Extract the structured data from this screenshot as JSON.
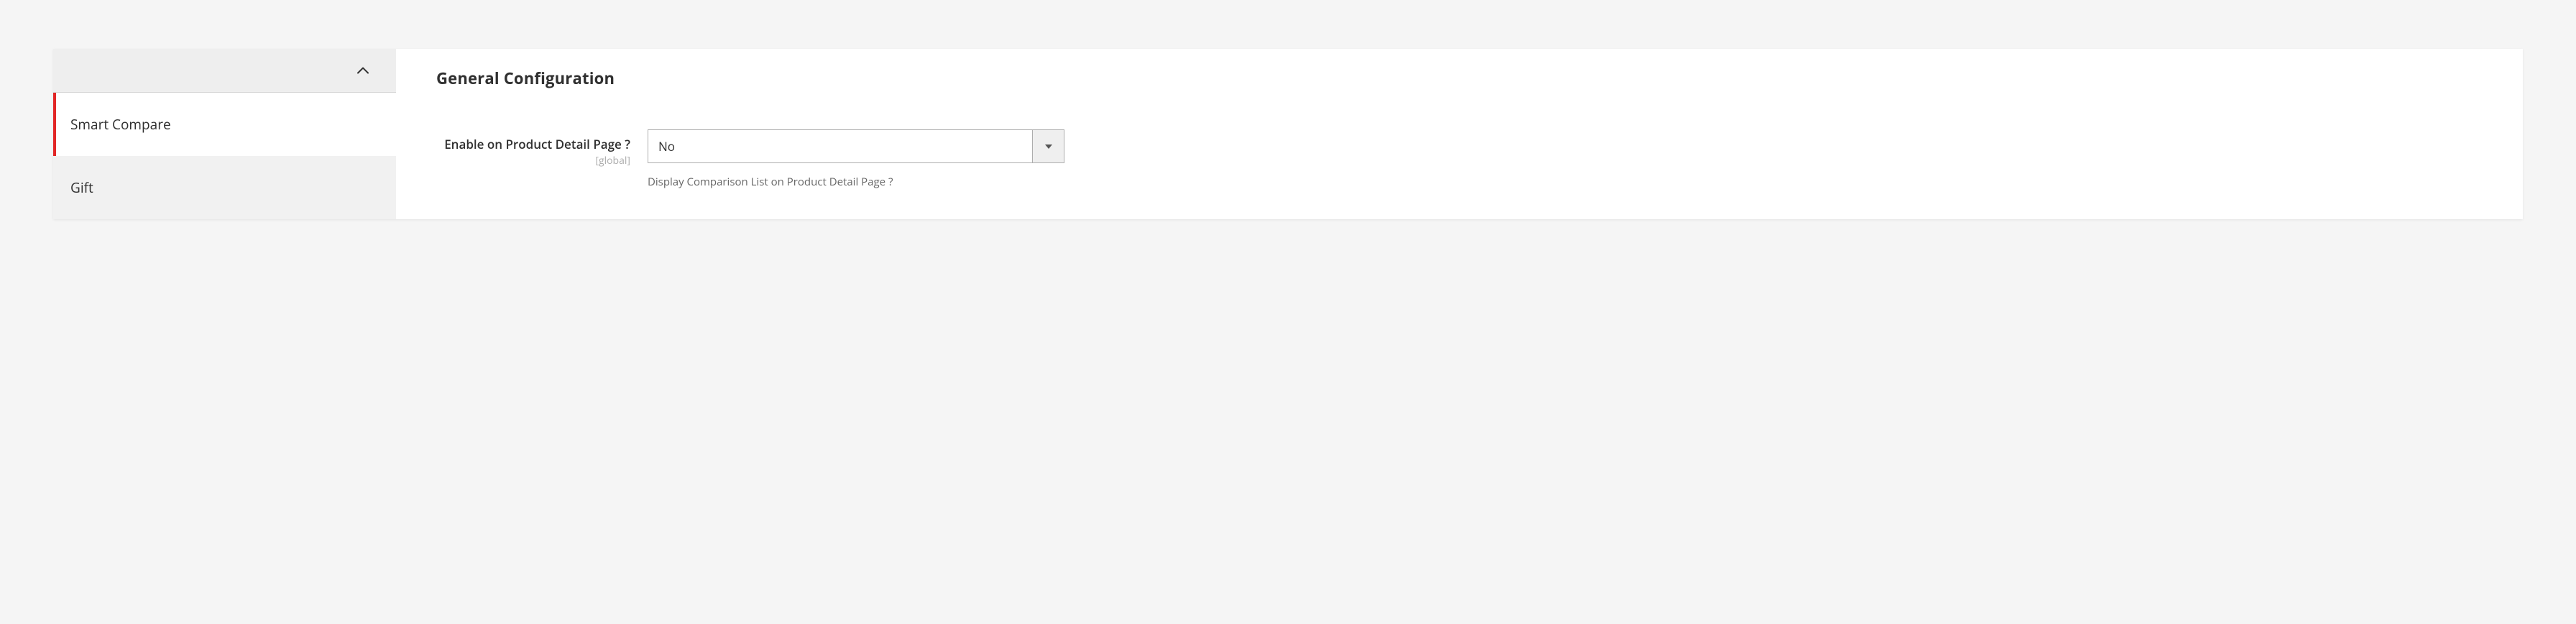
{
  "sidebar": {
    "items": [
      {
        "label": "Smart Compare",
        "active": true
      },
      {
        "label": "Gift",
        "active": false
      }
    ]
  },
  "content": {
    "section_title": "General Configuration",
    "fields": {
      "enable_pdp": {
        "label": "Enable on Product Detail Page ?",
        "scope": "[global]",
        "value": "No",
        "hint": "Display Comparison List on Product Detail Page ?"
      }
    }
  }
}
